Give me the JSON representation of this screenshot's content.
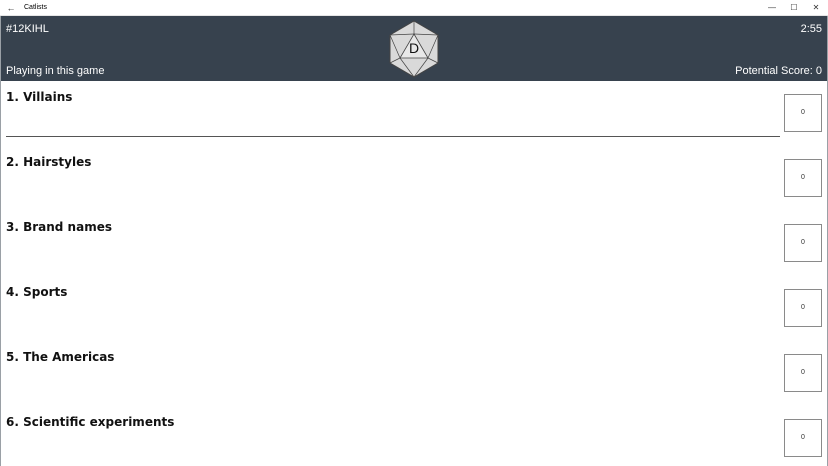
{
  "window": {
    "back_glyph": "←",
    "title": "Catlists",
    "minimize_glyph": "—",
    "maximize_glyph": "☐",
    "close_glyph": "✕"
  },
  "header": {
    "game_code": "#12KIHL",
    "timer": "2:55",
    "status": "Playing in this game",
    "score_label": "Potential Score:",
    "score_value": "0",
    "die_letter": "D",
    "die_icon": "d20-die-icon"
  },
  "categories": [
    {
      "label": "1. Villains",
      "value": "",
      "score": "0"
    },
    {
      "label": "2. Hairstyles",
      "value": "",
      "score": "0"
    },
    {
      "label": "3. Brand names",
      "value": "",
      "score": "0"
    },
    {
      "label": "4. Sports",
      "value": "",
      "score": "0"
    },
    {
      "label": "5. The Americas",
      "value": "",
      "score": "0"
    },
    {
      "label": "6. Scientific experiments",
      "value": "",
      "score": "0"
    }
  ]
}
